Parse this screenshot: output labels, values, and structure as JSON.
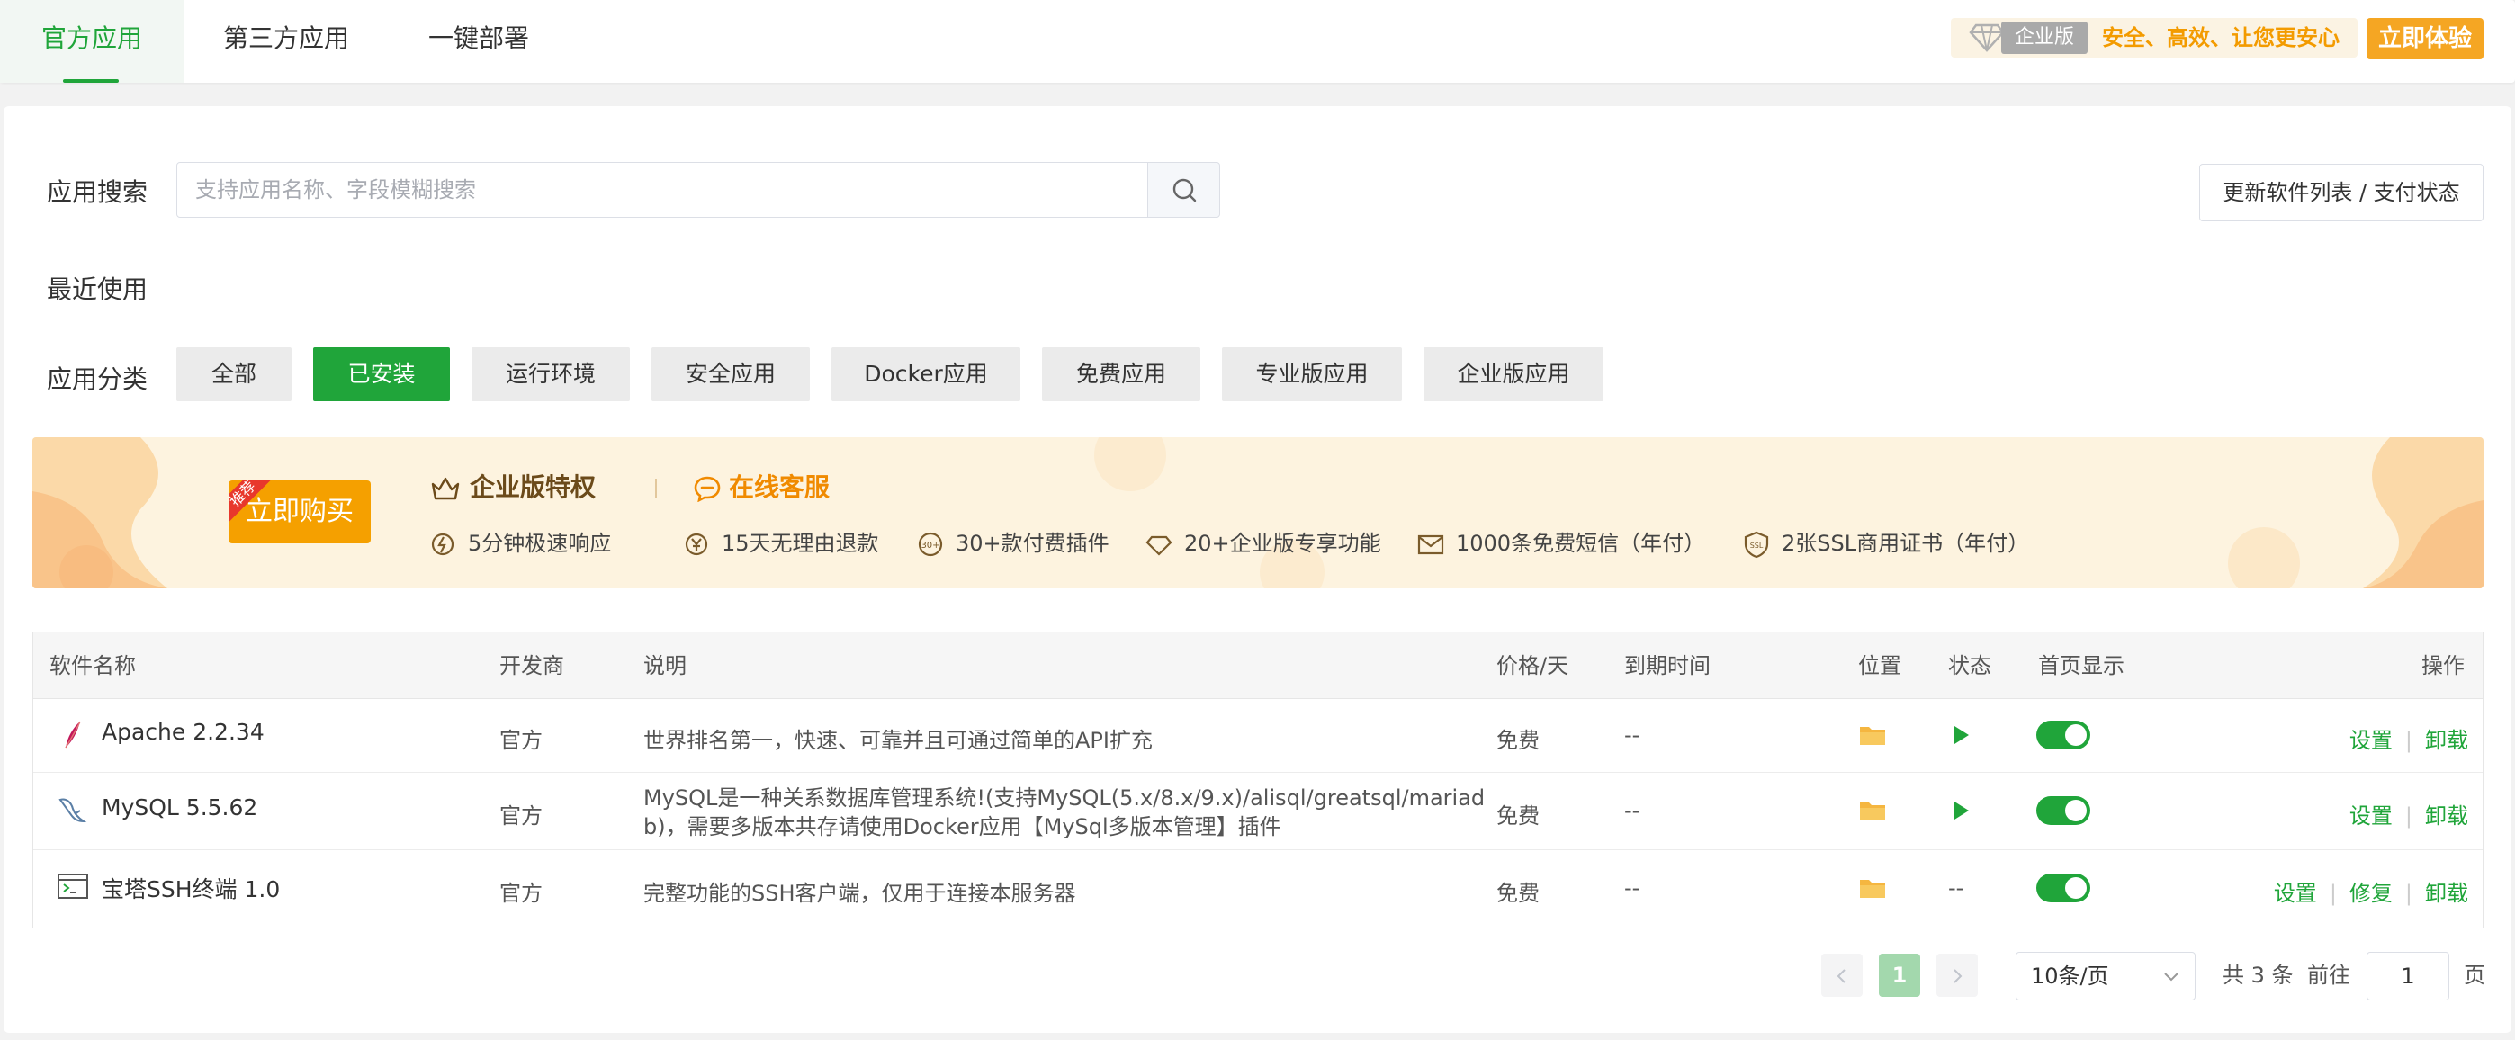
{
  "tabs": [
    {
      "label": "官方应用",
      "active": true
    },
    {
      "label": "第三方应用",
      "active": false
    },
    {
      "label": "一键部署",
      "active": false
    }
  ],
  "enterprise_banner": {
    "badge": "企业版",
    "slogan": "安全、高效、让您更安心",
    "try_button": "立即体验"
  },
  "search": {
    "label": "应用搜索",
    "placeholder": "支持应用名称、字段模糊搜索",
    "value": ""
  },
  "update_button": "更新软件列表 / 支付状态",
  "recent_label": "最近使用",
  "category": {
    "label": "应用分类",
    "items": [
      "全部",
      "已安装",
      "运行环境",
      "安全应用",
      "Docker应用",
      "免费应用",
      "专业版应用",
      "企业版应用"
    ],
    "active": "已安装"
  },
  "promo": {
    "buy_button": "立即购买",
    "ribbon": "推荐",
    "privilege_title": "企业版特权",
    "service_title": "在线客服",
    "features": [
      "5分钟极速响应",
      "15天无理由退款",
      "30+款付费插件",
      "20+企业版专享功能",
      "1000条免费短信（年付）",
      "2张SSL商用证书（年付）"
    ]
  },
  "table": {
    "headers": {
      "name": "软件名称",
      "developer": "开发商",
      "description": "说明",
      "price": "价格/天",
      "expire": "到期时间",
      "location": "位置",
      "status": "状态",
      "homepage": "首页显示",
      "actions": "操作"
    },
    "rows": [
      {
        "name": "Apache 2.2.34",
        "developer": "官方",
        "description_line1": "世界排名第一，快速、可靠并且可通过简单的API扩充",
        "description_line2": "",
        "price": "免费",
        "expire": "--",
        "status": "running",
        "status_text": "",
        "homepage": true,
        "actions": [
          "设置",
          "卸载"
        ]
      },
      {
        "name": "MySQL 5.5.62",
        "developer": "官方",
        "description_line1": "MySQL是一种关系数据库管理系统!(支持MySQL(5.x/8.x/9.x)/alisql/greatsql/mariad",
        "description_line2": "b)，需要多版本共存请使用Docker应用【MySql多版本管理】插件",
        "price": "免费",
        "expire": "--",
        "status": "running",
        "status_text": "",
        "homepage": true,
        "actions": [
          "设置",
          "卸载"
        ]
      },
      {
        "name": "宝塔SSH终端 1.0",
        "developer": "官方",
        "description_line1": "完整功能的SSH客户端，仅用于连接本服务器",
        "description_line2": "",
        "price": "免费",
        "expire": "--",
        "status": "none",
        "status_text": "--",
        "homepage": true,
        "actions": [
          "设置",
          "修复",
          "卸载"
        ]
      }
    ]
  },
  "pagination": {
    "current": "1",
    "page_size": "10条/页",
    "total": "共 3 条",
    "goto_label": "前往",
    "goto_value": "1",
    "page_suffix": "页"
  },
  "colors": {
    "primary": "#20a53a",
    "warning": "#f5a623",
    "promo_bg": "#fdf3df"
  }
}
